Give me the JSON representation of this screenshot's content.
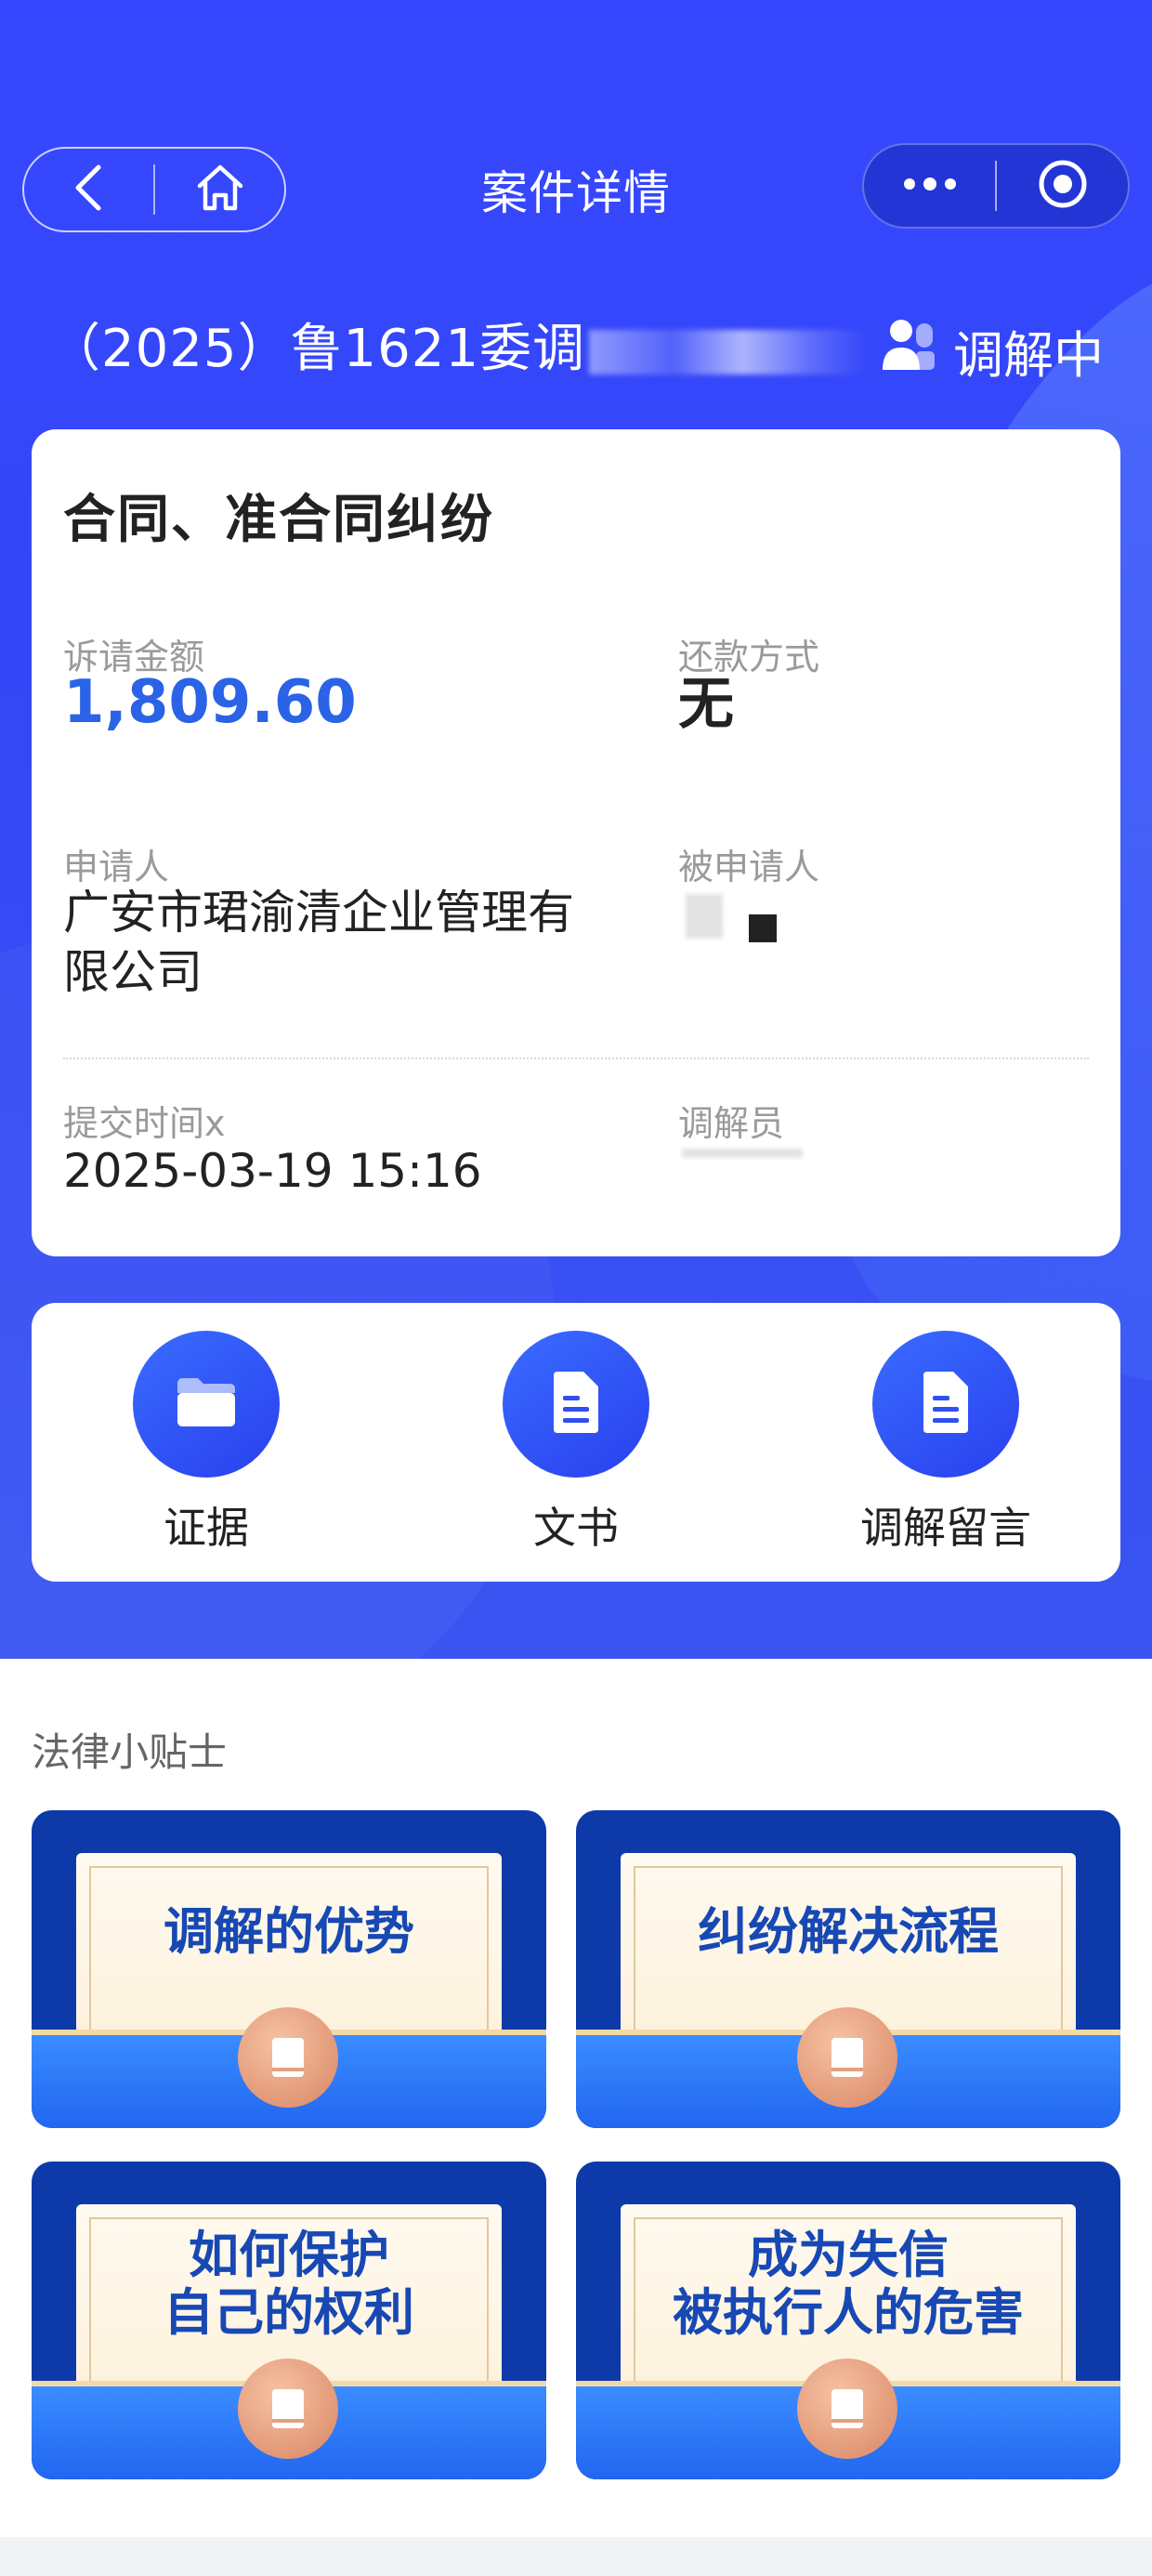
{
  "nav": {
    "title": "案件详情",
    "back_icon": "back-arrow-icon",
    "home_icon": "home-icon",
    "more_icon": "more-dots-icon",
    "close_icon": "target-circle-icon"
  },
  "case": {
    "number_prefix": "（2025）鲁1621委调",
    "status": "调解中",
    "type": "合同、准合同纠纷",
    "fields": {
      "amount_label": "诉请金额",
      "amount_value": "1,809.60",
      "repayment_label": "还款方式",
      "repayment_value": "无",
      "applicant_label": "申请人",
      "applicant_value": "广安市珺渝清企业管理有限公司",
      "respondent_label": "被申请人",
      "submit_label": "提交时间x",
      "submit_value": "2025-03-19 15:16",
      "mediator_label": "调解员"
    }
  },
  "actions": [
    {
      "label": "证据",
      "icon": "folder-icon"
    },
    {
      "label": "文书",
      "icon": "document-icon"
    },
    {
      "label": "调解留言",
      "icon": "document-icon"
    }
  ],
  "tips": {
    "title": "法律小贴士",
    "items": [
      {
        "line1": "调解的优势",
        "line2": ""
      },
      {
        "line1": "纠纷解决流程",
        "line2": ""
      },
      {
        "line1": "如何保护",
        "line2": "自己的权利"
      },
      {
        "line1": "成为失信",
        "line2": "被执行人的危害"
      }
    ]
  },
  "colors": {
    "primary": "#3447f6",
    "amount": "#2a63e6",
    "tip_text": "#1748b4"
  }
}
